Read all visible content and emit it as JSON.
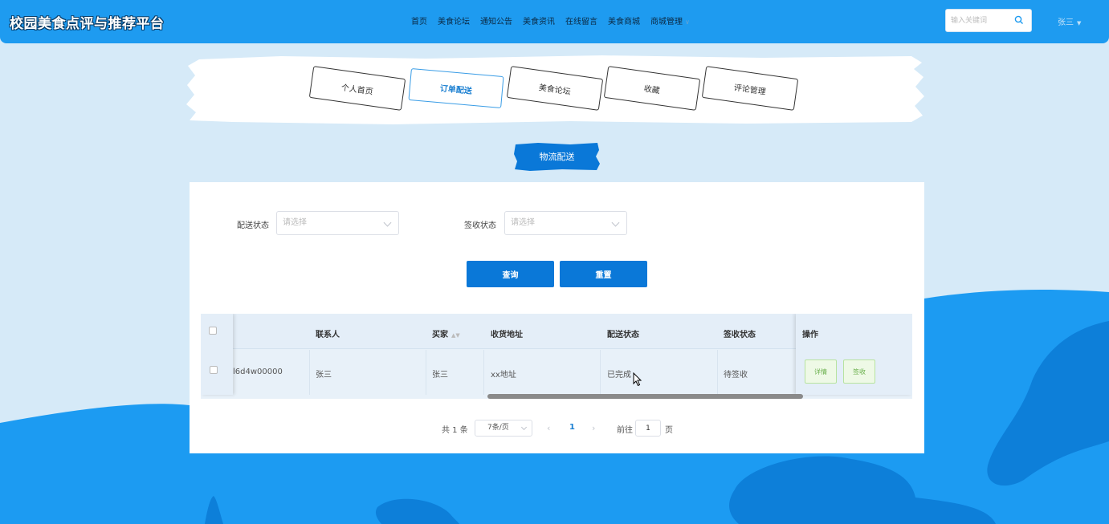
{
  "header": {
    "site_title": "校园美食点评与推荐平台",
    "nav": [
      "首页",
      "美食论坛",
      "通知公告",
      "美食资讯",
      "在线留言",
      "美食商城",
      "商城管理"
    ],
    "search_placeholder": "输入关键词",
    "user_name": "张三"
  },
  "tabs": [
    {
      "label": "个人首页",
      "active": false
    },
    {
      "label": "订单配送",
      "active": true
    },
    {
      "label": "美食论坛",
      "active": false
    },
    {
      "label": "收藏",
      "active": false
    },
    {
      "label": "评论管理",
      "active": false
    }
  ],
  "section_title": "物流配送",
  "filters": {
    "delivery_status_label": "配送状态",
    "delivery_status_placeholder": "请选择",
    "sign_status_label": "签收状态",
    "sign_status_placeholder": "请选择",
    "search_button": "查询",
    "reset_button": "重置"
  },
  "table": {
    "columns": [
      "联系人",
      "买家",
      "收货地址",
      "配送状态",
      "签收状态",
      "操作"
    ],
    "rows": [
      {
        "order_no": "l6d4w00000",
        "contact": "张三",
        "buyer": "张三",
        "address": "xx地址",
        "delivery_status": "已完成",
        "sign_status": "待签收",
        "actions": [
          "详情",
          "签收"
        ]
      }
    ]
  },
  "pagination": {
    "total": "共 1 条",
    "page_size": "7条/页",
    "current_page": "1",
    "goto_label": "前往",
    "goto_value": "1",
    "page_suffix": "页"
  },
  "colors": {
    "header_bg": "#1e9bf0",
    "primary_button": "#0a78d8",
    "page_bg": "#d6eaf8",
    "wave_light": "#1c9bf2",
    "wave_dark": "#0d7fd9"
  }
}
